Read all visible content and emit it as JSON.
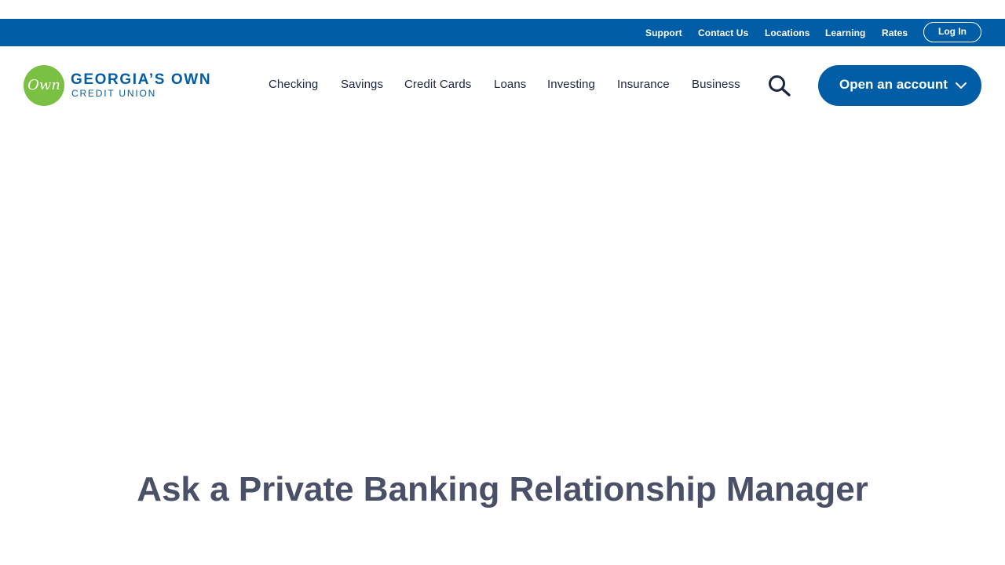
{
  "utility_nav": {
    "links": [
      "Support",
      "Contact Us",
      "Locations",
      "Learning",
      "Rates"
    ],
    "login_label": "Log In"
  },
  "logo": {
    "mark_text": "Own",
    "line1": "GEORGIA’S OWN",
    "line2": "CREDIT UNION"
  },
  "main_nav": {
    "items": [
      "Checking",
      "Savings",
      "Credit Cards",
      "Loans",
      "Investing",
      "Insurance",
      "Business"
    ],
    "cta_label": "Open an account"
  },
  "icons": {
    "search": "search-icon",
    "cta_chevron": "chevron-down-icon"
  },
  "colors": {
    "brand_blue": "#005da6",
    "logo_green": "#7ac143",
    "nav_text": "#1c2541",
    "heading_text": "#495067"
  },
  "hero": {
    "title": "Ask a Private Banking Relationship Manager"
  }
}
